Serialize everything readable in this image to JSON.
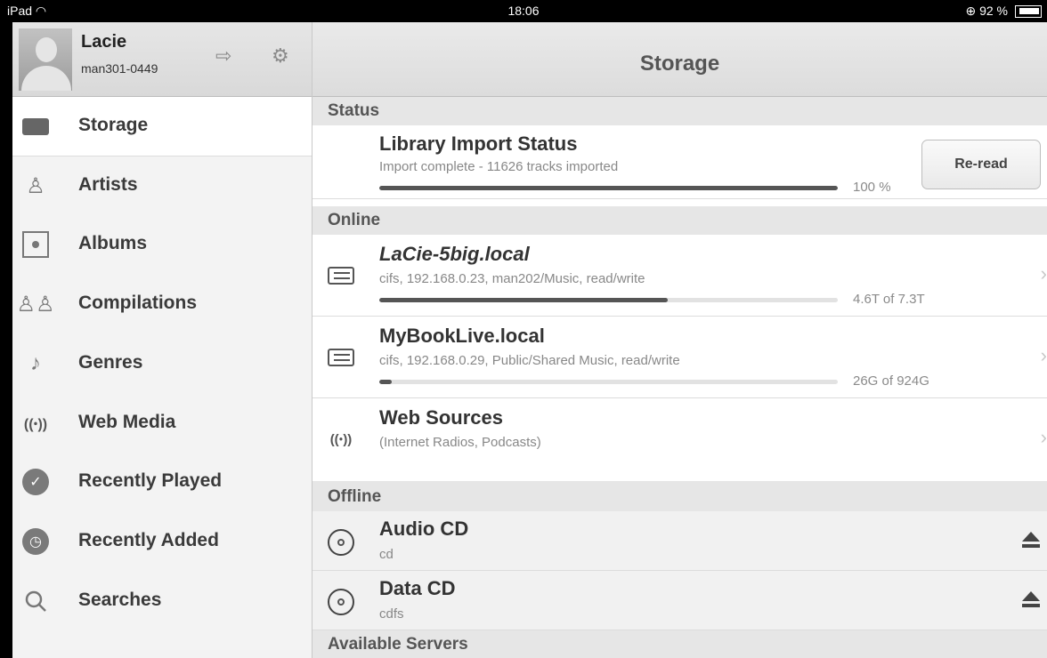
{
  "status_bar": {
    "device": "iPad",
    "time": "18:06",
    "battery": "92 %"
  },
  "user": {
    "name": "Lacie",
    "id": "man301-0449"
  },
  "sidebar": {
    "items": [
      {
        "label": "Storage",
        "icon": "storage-icon",
        "active": true
      },
      {
        "label": "Artists",
        "icon": "artist-icon"
      },
      {
        "label": "Albums",
        "icon": "album-icon"
      },
      {
        "label": "Compilations",
        "icon": "compilations-icon"
      },
      {
        "label": "Genres",
        "icon": "guitar-icon"
      },
      {
        "label": "Web Media",
        "icon": "antenna-icon"
      },
      {
        "label": "Recently Played",
        "icon": "clock-check-icon"
      },
      {
        "label": "Recently Added",
        "icon": "clock-icon"
      },
      {
        "label": "Searches",
        "icon": "search-icon"
      }
    ]
  },
  "main": {
    "title": "Storage",
    "sections": {
      "status": "Status",
      "online": "Online",
      "offline": "Offline",
      "servers": "Available Servers"
    },
    "library": {
      "title": "Library Import Status",
      "subtitle": "Import complete - 11626 tracks imported",
      "progress": 1.0,
      "percent": "100 %",
      "button": "Re-read"
    },
    "online": [
      {
        "title": "LaCie-5big.local",
        "subtitle": "cifs, 192.168.0.23, man202/Music, read/write",
        "usage": "4.6T of 7.3T",
        "fraction": 0.63
      },
      {
        "title": "MyBookLive.local",
        "subtitle": "cifs, 192.168.0.29, Public/Shared Music, read/write",
        "usage": "26G of 924G",
        "fraction": 0.028
      },
      {
        "title": "Web Sources",
        "subtitle": "(Internet Radios, Podcasts)"
      }
    ],
    "offline": [
      {
        "title": "Audio CD",
        "subtitle": "cd"
      },
      {
        "title": "Data CD",
        "subtitle": "cdfs"
      }
    ]
  },
  "colors": {
    "accent": "#555555",
    "section_bg": "#e6e6e6",
    "sidebar_bg": "#f3f3f3"
  }
}
